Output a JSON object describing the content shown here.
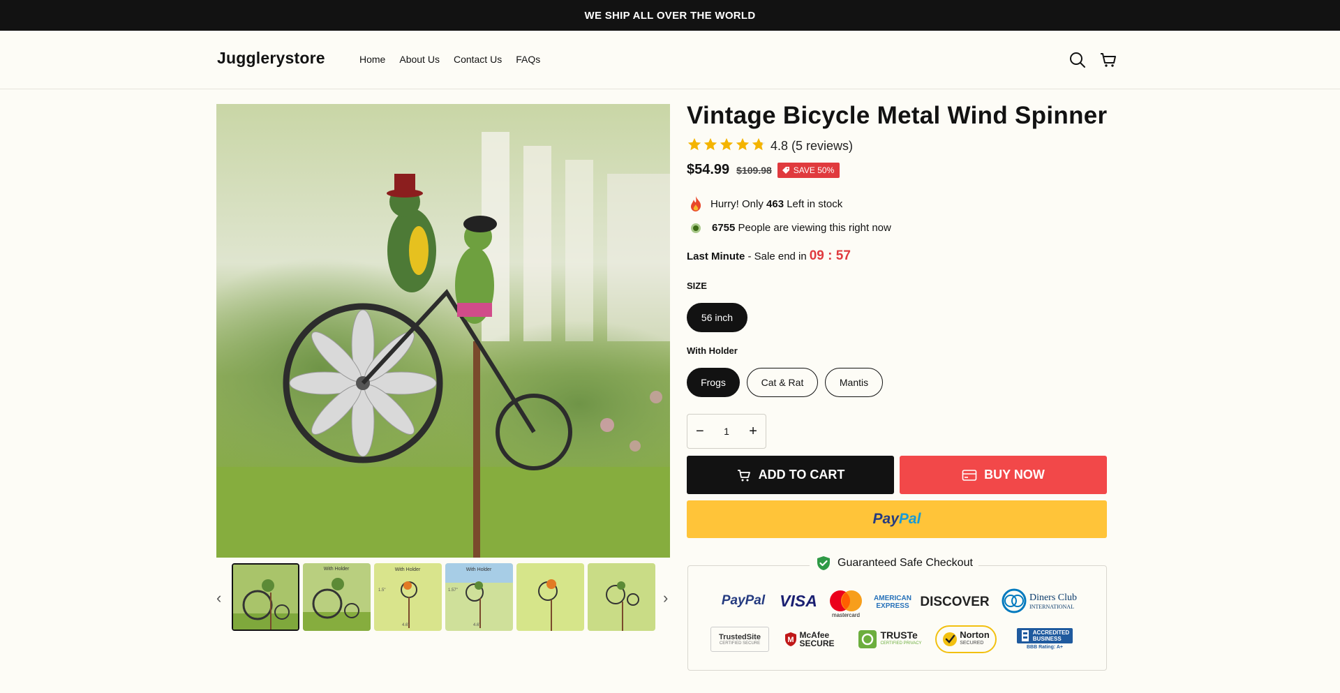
{
  "announcement": "WE SHIP ALL OVER THE WORLD",
  "header": {
    "logo": "Jugglerystore",
    "nav": [
      "Home",
      "About Us",
      "Contact Us",
      "FAQs"
    ]
  },
  "product": {
    "title": "Vintage Bicycle Metal Wind Spinner",
    "rating_text": "4.8 (5 reviews)",
    "rating_value": 4.8,
    "price": "$54.99",
    "compare_price": "$109.98",
    "save_badge": "SAVE 50%",
    "stock": {
      "prefix": "Hurry! Only ",
      "count": "463",
      "suffix": " Left in stock"
    },
    "viewers": {
      "count": "6755",
      "suffix": " People are viewing this right now"
    },
    "sale_end": {
      "strong": "Last Minute",
      "text": " - Sale end in",
      "timer": "09 : 57"
    },
    "size": {
      "label": "SIZE",
      "options": [
        "56 inch"
      ],
      "selected": "56 inch"
    },
    "holder": {
      "label": "With Holder",
      "options": [
        "Frogs",
        "Cat & Rat",
        "Mantis"
      ],
      "selected": "Frogs"
    },
    "quantity": {
      "minus": "−",
      "value": "1",
      "plus": "+"
    },
    "add_to_cart": "ADD TO CART",
    "buy_now": "BUY NOW",
    "paypal": {
      "pay": "Pay",
      "pal": "Pal"
    }
  },
  "gallery": {
    "thumb_captions": [
      "",
      "With Holder",
      "With Holder",
      "With Holder",
      "",
      ""
    ],
    "thumb_marks": [
      "",
      "",
      "1.5\"",
      "1.57\"",
      "",
      ""
    ],
    "thumb_bottoms": [
      "",
      "",
      "4.6\"",
      "4.6\"",
      "",
      ""
    ]
  },
  "trust": {
    "heading": "Guaranteed Safe Checkout",
    "payments": {
      "paypal": "PayPal",
      "visa": "VISA",
      "mastercard": "mastercard",
      "amex": [
        "AMERICAN",
        "EXPRESS"
      ],
      "discover": "DISCOVER",
      "diners": [
        "Diners Club",
        "INTERNATIONAL"
      ]
    },
    "seals": {
      "trustedsite": [
        "TrustedSite",
        "CERTIFIED SECURE"
      ],
      "mcafee": [
        "McAfee",
        "SECURE"
      ],
      "truste": [
        "TRUSTe",
        "CERTIFIED PRIVACY"
      ],
      "norton": [
        "Norton",
        "SECURED"
      ],
      "bbb": [
        "ACCREDITED",
        "BUSINESS",
        "BBB Rating: A+"
      ]
    }
  },
  "colors": {
    "accent_red": "#e03a3e",
    "dark": "#121212",
    "paypal_yellow": "#ffc439",
    "background": "#fdfcf6"
  }
}
